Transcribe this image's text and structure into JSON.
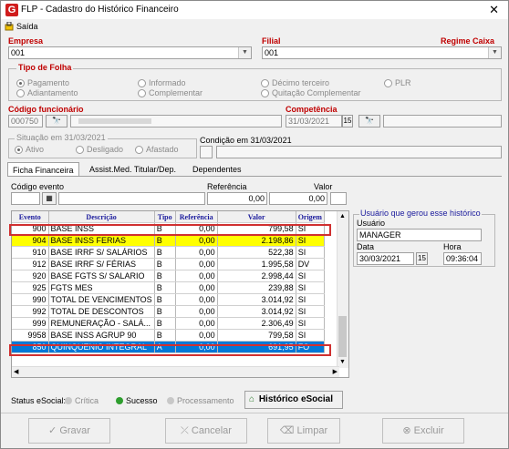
{
  "window": {
    "title": "FLP - Cadastro do Histórico Financeiro",
    "close": "✕",
    "logo": "G"
  },
  "menu": {
    "exit_label": "Saída"
  },
  "empresa": {
    "label": "Empresa",
    "value": "001"
  },
  "filial": {
    "label": "Filial",
    "value": "001"
  },
  "regime": {
    "label": "Regime Caixa"
  },
  "tipo_folha": {
    "label": "Tipo de Folha",
    "options": [
      "Pagamento",
      "Informado",
      "Décimo terceiro",
      "PLR",
      "Adiantamento",
      "Complementar",
      "Quitação Complementar"
    ]
  },
  "codigo_funcionario": {
    "label": "Código funcionário",
    "value": "000750"
  },
  "competencia": {
    "label": "Competência",
    "value": "31/03/2021"
  },
  "situacao": {
    "label": "Situação em 31/03/2021",
    "options": [
      "Ativo",
      "Desligado",
      "Afastado"
    ]
  },
  "condicao": {
    "label": "Condição em 31/03/2021"
  },
  "tabs": [
    "Ficha Financeira",
    "Assist.Med. Titular/Dep.",
    "Dependentes"
  ],
  "evento": {
    "codigo_label": "Código evento",
    "referencia_label": "Referência",
    "valor_label": "Valor",
    "referencia_value": "0,00",
    "valor_value": "0,00"
  },
  "table": {
    "columns": [
      "Evento",
      "Descrição",
      "Tipo",
      "Referência",
      "Valor",
      "Origem"
    ],
    "rows": [
      [
        "900",
        "BASE INSS",
        "B",
        "0,00",
        "799,58",
        "SI"
      ],
      [
        "904",
        "BASE INSS FERIAS",
        "B",
        "0,00",
        "2.198,86",
        "SI"
      ],
      [
        "910",
        "BASE IRRF S/ SALÁRIOS",
        "B",
        "0,00",
        "522,38",
        "SI"
      ],
      [
        "912",
        "BASE IRRF S/ FÉRIAS",
        "B",
        "0,00",
        "1.995,58",
        "DV"
      ],
      [
        "920",
        "BASE FGTS S/ SALARIO",
        "B",
        "0,00",
        "2.998,44",
        "SI"
      ],
      [
        "925",
        "FGTS MES",
        "B",
        "0,00",
        "239,88",
        "SI"
      ],
      [
        "990",
        "TOTAL DE VENCIMENTOS",
        "B",
        "0,00",
        "3.014,92",
        "SI"
      ],
      [
        "992",
        "TOTAL DE DESCONTOS",
        "B",
        "0,00",
        "3.014,92",
        "SI"
      ],
      [
        "999",
        "REMUNERAÇÃO - SALÁ...",
        "B",
        "0,00",
        "2.306,49",
        "SI"
      ],
      [
        "9958",
        "BASE INSS AGRUP 90",
        "B",
        "0,00",
        "799,58",
        "SI"
      ],
      [
        "850",
        "QUINQUENIO INTEGRAL",
        "A",
        "0,00",
        "691,95",
        "FO"
      ]
    ]
  },
  "usuario": {
    "group_label": "Usuário que gerou esse histórico",
    "usuario_label": "Usuário",
    "usuario_value": "MANAGER",
    "data_label": "Data",
    "data_value": "30/03/2021",
    "hora_label": "Hora",
    "hora_value": "09:36:04"
  },
  "status": {
    "label": "Status eSocial:",
    "items": [
      "Crítica",
      "Sucesso",
      "Processamento"
    ],
    "historico_button": "Histórico eSocial"
  },
  "buttons": {
    "gravar": "Gravar",
    "cancelar": "Cancelar",
    "limpar": "Limpar",
    "excluir": "Excluir"
  },
  "colors": {
    "highlight": "#ffff00",
    "selection": "#0078d7",
    "outline": "#d03030",
    "accent_red": "#c00000",
    "success_green": "#2e9e2e"
  }
}
